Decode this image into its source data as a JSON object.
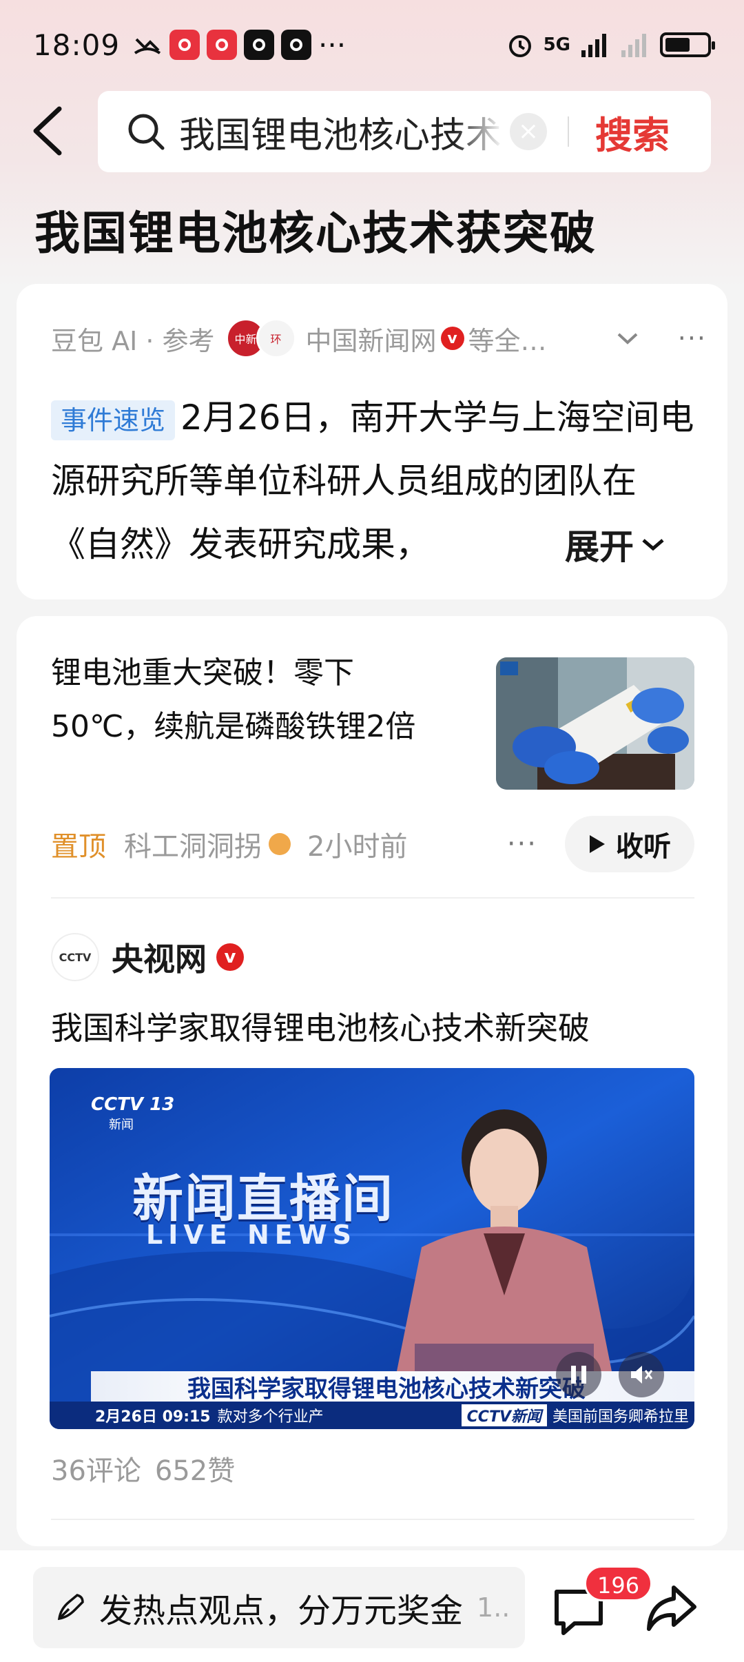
{
  "status_bar": {
    "time": "18:09",
    "network": "5G",
    "more": "···"
  },
  "search": {
    "query": "我国锂电池核心技术获突破",
    "submit_label": "搜索"
  },
  "page_title": "我国锂电池核心技术获突破",
  "ai_summary": {
    "source_label": "豆包 AI · 参考",
    "source_name": "中国新闻网",
    "source_more": "等全…",
    "tag": "事件速览",
    "text": "2月26日，南开大学与上海空间电源研究所等单位科研人员组成的团队在《自然》发表研究成果，",
    "expand_label": "展开"
  },
  "feed": {
    "article": {
      "title": "锂电池重大突破！零下50℃，续航是磷酸铁锂2倍",
      "pinned_label": "置顶",
      "author": "科工洞洞拐",
      "time_ago": "2小时前",
      "listen_label": "收听"
    },
    "video_post": {
      "channel": "央视网",
      "title": "我国科学家取得锂电池核心技术新突破",
      "overlay": {
        "channel_logo": "CCTV 13",
        "channel_sub": "新闻",
        "program_name": "新闻直播间",
        "program_en": "LIVE NEWS",
        "caption": "我国科学家取得锂电池核心技术新突破",
        "date_time": "2月26日 09:15",
        "ticker_left": "款对多个行业产",
        "ticker_logo": "CCTV新闻",
        "ticker_right": "美国前国务卿希拉里"
      },
      "comments": "36评论",
      "likes": "652赞"
    }
  },
  "bottom_bar": {
    "comment_placeholder": "发热点观点，分万元奖金",
    "comment_suffix": "1..",
    "comment_count": "196"
  },
  "colors": {
    "accent_red": "#e53935",
    "tag_blue": "#2f7bd6",
    "pin_orange": "#e0902a"
  }
}
